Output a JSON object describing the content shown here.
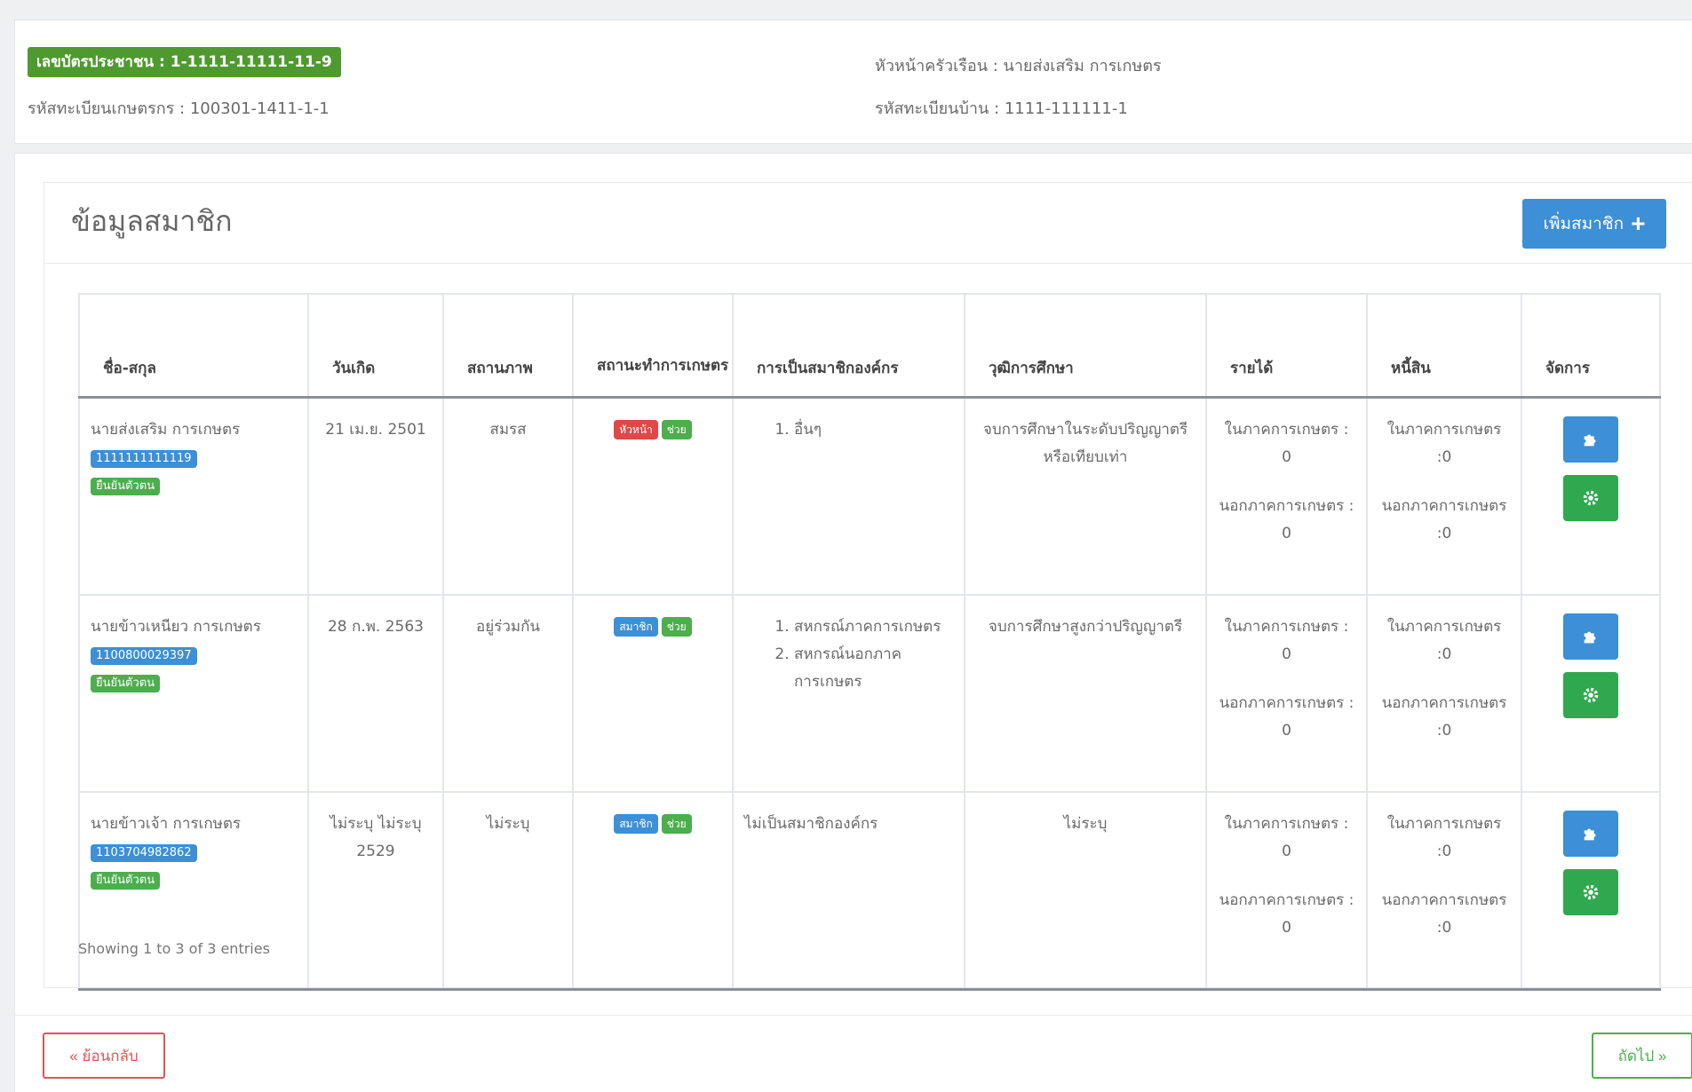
{
  "household": {
    "citizen_id_badge": "เลขบัตรประชาชน : 1-1111-11111-11-9",
    "farmer_reg_code": "รหัสทะเบียนเกษตรกร : 100301-1411-1-1",
    "head_of_household": "หัวหน้าครัวเรือน : นายส่งเสริม การเกษตร",
    "house_reg_code": "รหัสทะเบียนบ้าน : 1111-111111-1"
  },
  "members_panel": {
    "title": "ข้อมูลสมาชิก",
    "add_button_label": "เพิ่มสมาชิก",
    "columns": [
      "ชื่อ-สกุล",
      "วันเกิด",
      "สถานภาพ",
      "สถานะทำการเกษตร",
      "การเป็นสมาชิกองค์กร",
      "วุฒิการศึกษา",
      "รายได้",
      "หนี้สิน",
      "จัดการ"
    ],
    "rows": [
      {
        "name": "นายส่งเสริม การเกษตร",
        "id_tag": "1111111111119",
        "role_tag": "ยืนยันตัวตน",
        "birthdate": "21 เม.ย. 2501",
        "marital_status": "สมรส",
        "farm_tag_1": "หัวหน้า",
        "farm_tag_2": "ช่วย",
        "orgs": [
          "อื่นๆ"
        ],
        "education": "จบการศึกษาในระดับปริญญาตรีหรือเทียบเท่า",
        "income_in": "ในภาคการเกษตร : 0",
        "income_out": "นอกภาคการเกษตร : 0",
        "debt_in": "ในภาคการเกษตร :0",
        "debt_out": "นอกภาคการเกษตร :0"
      },
      {
        "name": "นายข้าวเหนียว การเกษตร",
        "id_tag": "1100800029397",
        "role_tag": "ยืนยันตัวตน",
        "birthdate": "28 ก.พ. 2563",
        "marital_status": "อยู่ร่วมกัน",
        "farm_tag_1": "สมาชิก",
        "farm_tag_2": "ช่วย",
        "orgs": [
          "สหกรณ์ภาคการเกษตร",
          "สหกรณ์นอกภาคการเกษตร"
        ],
        "education": "จบการศึกษาสูงกว่าปริญญาตรี",
        "income_in": "ในภาคการเกษตร : 0",
        "income_out": "นอกภาคการเกษตร : 0",
        "debt_in": "ในภาคการเกษตร :0",
        "debt_out": "นอกภาคการเกษตร :0"
      },
      {
        "name": "นายข้าวเจ้า การเกษตร",
        "id_tag": "1103704982862",
        "role_tag": "ยืนยันตัวตน",
        "birthdate": "ไม่ระบุ ไม่ระบุ 2529",
        "marital_status": "ไม่ระบุ",
        "farm_tag_1": "สมาชิก",
        "farm_tag_2": "ช่วย",
        "orgs_text": "ไม่เป็นสมาชิกองค์กร",
        "education": "ไม่ระบุ",
        "income_in": "ในภาคการเกษตร : 0",
        "income_out": "นอกภาคการเกษตร : 0",
        "debt_in": "ในภาคการเกษตร :0",
        "debt_out": "นอกภาคการเกษตร :0"
      }
    ],
    "showing_text": "Showing 1 to 3 of 3 entries"
  },
  "footer": {
    "back_label": "« ย้อนกลับ",
    "next_label": "ถัดไป »"
  },
  "colors": {
    "primary": "#3d8fd6",
    "success": "#2fa84f",
    "danger": "#e04848",
    "badge_green": "#4e9a2f"
  }
}
